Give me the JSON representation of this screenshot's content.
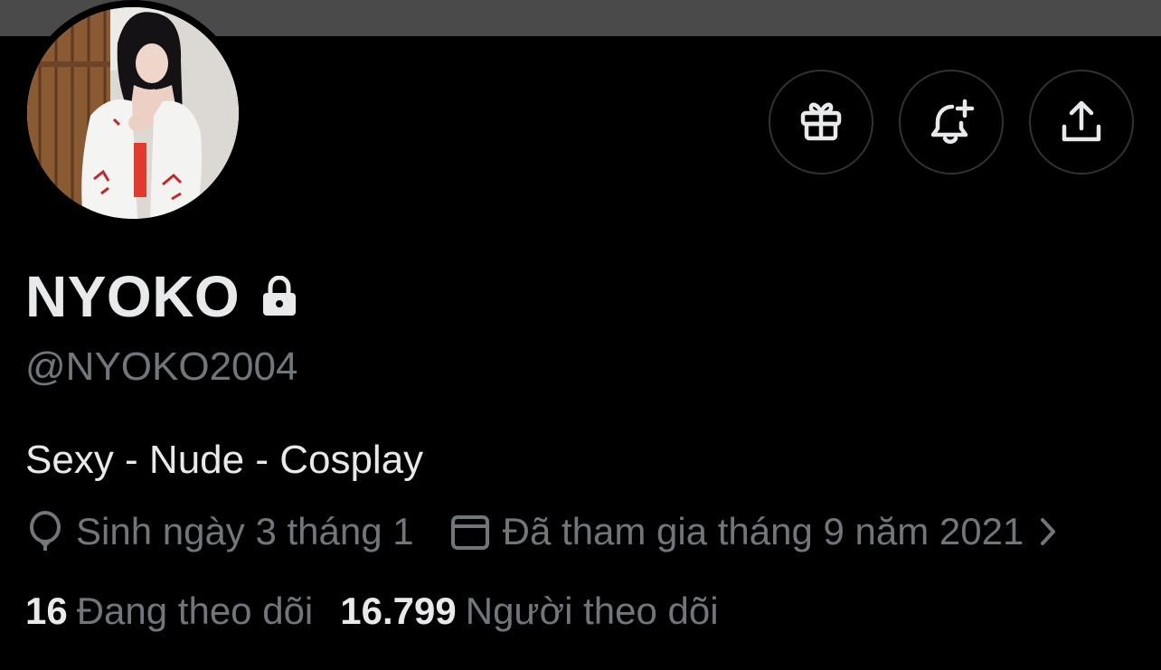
{
  "profile": {
    "display_name": "NYOKO",
    "handle": "@NYOKO2004",
    "bio": "Sexy - Nude - Cosplay",
    "protected_icon": "lock-icon"
  },
  "actions": {
    "gift_icon": "gift-icon",
    "notify_icon": "bell-plus-icon",
    "share_icon": "share-icon"
  },
  "meta": {
    "birthday_icon": "balloon-icon",
    "birthday": "Sinh ngày 3 tháng 1",
    "joined_icon": "calendar-icon",
    "joined": "Đã tham gia tháng 9 năm 2021",
    "expand_icon": "chevron-right-icon"
  },
  "stats": {
    "following_count": "16",
    "following_label": "Đang theo dõi",
    "followers_count": "16.799",
    "followers_label": "Người theo dõi"
  },
  "colors": {
    "background": "#000000",
    "banner": "#4a4a4a",
    "primary_text": "#e7e9ea",
    "secondary_text": "#71767b",
    "button_border": "#2f3336"
  }
}
